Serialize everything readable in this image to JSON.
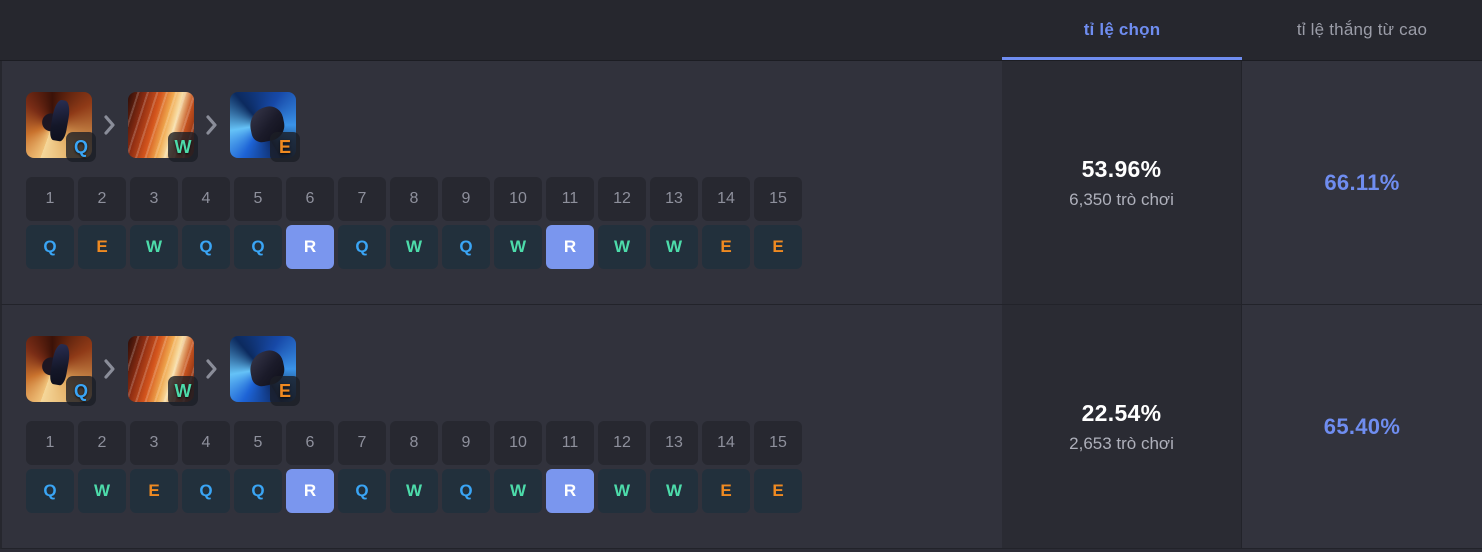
{
  "header": {
    "tabs": [
      {
        "label": "tỉ lệ chọn",
        "active": true
      },
      {
        "label": "tỉ lệ thắng từ cao",
        "active": false
      }
    ]
  },
  "colors": {
    "accent_blue": "#6f8df0",
    "key_q": "#3aa5f5",
    "key_w": "#4ddbaa",
    "key_e": "#f08a21",
    "key_r_bg": "#7a96ee",
    "page_bg": "#2c2d36",
    "header_bg": "#26272e",
    "row_bg": "#31323c",
    "pick_cell_bg": "#2a2b33"
  },
  "icons": {
    "chevron": "chevron-right-icon"
  },
  "rows": [
    {
      "abilities": [
        {
          "key": "Q",
          "art": "q"
        },
        {
          "key": "W",
          "art": "w"
        },
        {
          "key": "E",
          "art": "e"
        }
      ],
      "levels": [
        "1",
        "2",
        "3",
        "4",
        "5",
        "6",
        "7",
        "8",
        "9",
        "10",
        "11",
        "12",
        "13",
        "14",
        "15"
      ],
      "skills": [
        "Q",
        "E",
        "W",
        "Q",
        "Q",
        "R",
        "Q",
        "W",
        "Q",
        "W",
        "R",
        "W",
        "W",
        "E",
        "E"
      ],
      "pick_rate": "53.96%",
      "games": "6,350 trò chơi",
      "win_rate": "66.11%"
    },
    {
      "abilities": [
        {
          "key": "Q",
          "art": "q"
        },
        {
          "key": "W",
          "art": "w"
        },
        {
          "key": "E",
          "art": "e"
        }
      ],
      "levels": [
        "1",
        "2",
        "3",
        "4",
        "5",
        "6",
        "7",
        "8",
        "9",
        "10",
        "11",
        "12",
        "13",
        "14",
        "15"
      ],
      "skills": [
        "Q",
        "W",
        "E",
        "Q",
        "Q",
        "R",
        "Q",
        "W",
        "Q",
        "W",
        "R",
        "W",
        "W",
        "E",
        "E"
      ],
      "pick_rate": "22.54%",
      "games": "2,653 trò chơi",
      "win_rate": "65.40%"
    }
  ]
}
